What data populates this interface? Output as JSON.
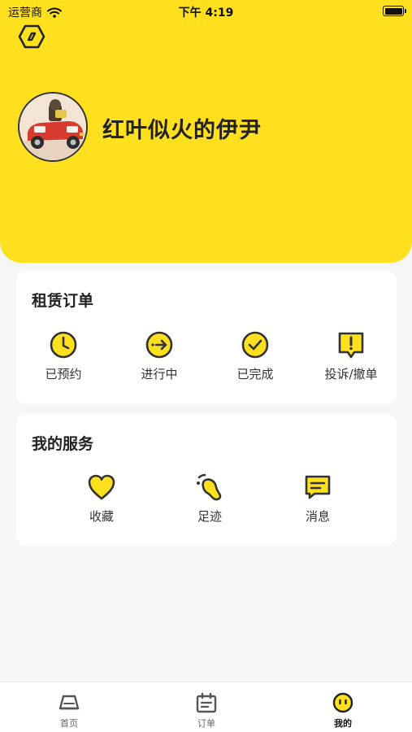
{
  "status_bar": {
    "carrier": "运营商",
    "time": "下午 4:19"
  },
  "profile": {
    "nickname": "红叶似火的伊尹"
  },
  "orders": {
    "title": "租赁订单",
    "items": [
      {
        "label": "已预约",
        "icon": "clock-icon"
      },
      {
        "label": "进行中",
        "icon": "arrow-right-icon"
      },
      {
        "label": "已完成",
        "icon": "check-icon"
      },
      {
        "label": "投诉/撤单",
        "icon": "exclamation-bubble-icon"
      }
    ]
  },
  "services": {
    "title": "我的服务",
    "items": [
      {
        "label": "收藏",
        "icon": "heart-icon"
      },
      {
        "label": "足迹",
        "icon": "footprint-icon"
      },
      {
        "label": "消息",
        "icon": "message-icon"
      }
    ]
  },
  "tabbar": {
    "items": [
      {
        "label": "首页",
        "icon": "home-icon"
      },
      {
        "label": "订单",
        "icon": "calendar-icon"
      },
      {
        "label": "我的",
        "icon": "smiley-icon",
        "active": true
      }
    ]
  },
  "colors": {
    "accent": "#ffe01f",
    "icon_stroke": "#333333",
    "background": "#f6f6f6"
  }
}
